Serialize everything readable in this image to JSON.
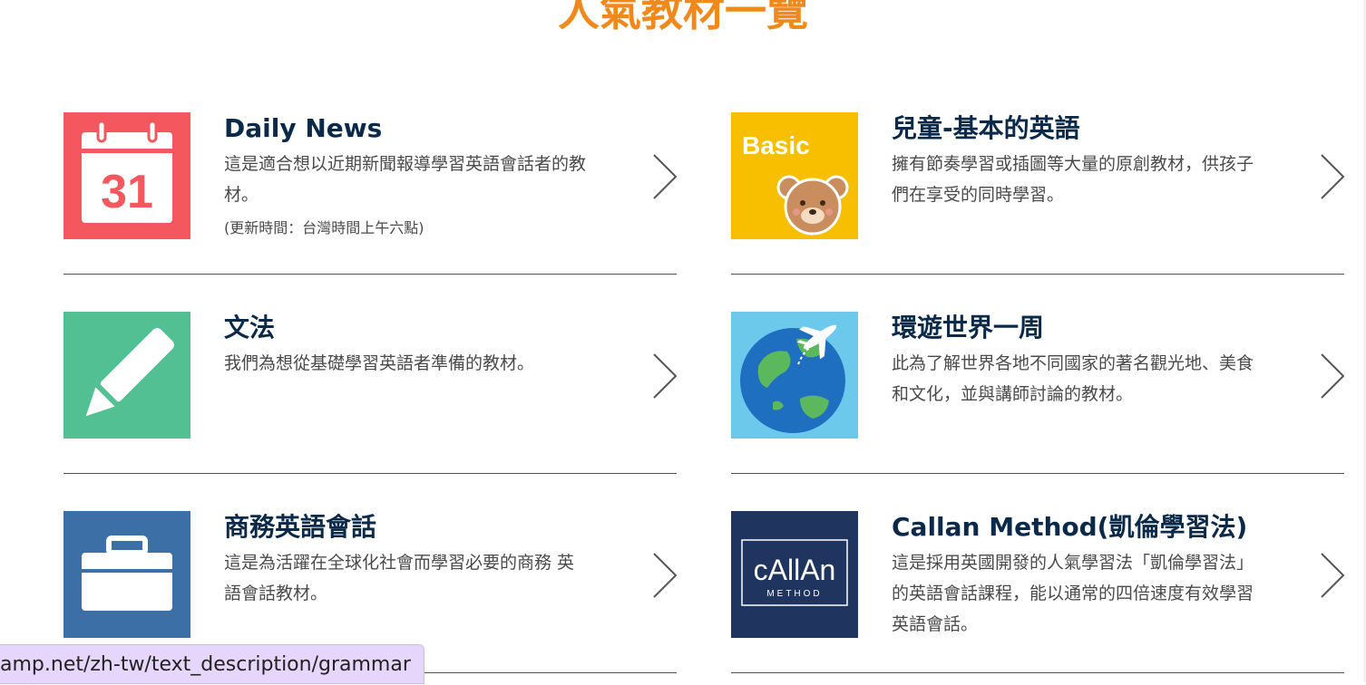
{
  "page": {
    "title": "人氣教材一覽"
  },
  "materials": [
    {
      "title": "Daily News",
      "description": "這是適合想以近期新聞報導學習英語會話者的教材。",
      "note": "(更新時間：台灣時間上午六點)",
      "icon": "calendar-icon",
      "icon_text": "31",
      "color": "#f4585e"
    },
    {
      "title": "兒童-基本的英語",
      "description": "擁有節奏學習或插圖等大量的原創教材，供孩子們在享受的同時學習。",
      "icon": "bear-icon",
      "icon_text": "Basic",
      "color": "#f8be00"
    },
    {
      "title": "文法",
      "description": "我們為想從基礎學習英語者準備的教材。",
      "icon": "pencil-icon",
      "color": "#53c094"
    },
    {
      "title": "環遊世界一周",
      "description": "此為了解世界各地不同國家的著名觀光地、美食和文化，並與講師討論的教材。",
      "icon": "globe-airplane-icon",
      "color": "#6cc9ec"
    },
    {
      "title": "商務英語會話",
      "description": "這是為活躍在全球化社會而學習必要的商務 英語會話教材。",
      "icon": "briefcase-icon",
      "color": "#3b6fa6"
    },
    {
      "title": "Callan Method(凱倫學習法)",
      "description": "這是採用英國開發的人氣學習法「凱倫學習法」的英語會話課程，能以通常的四倍速度有效學習英語會話。",
      "icon": "callan-logo-icon",
      "icon_text": "cAllAn",
      "icon_subtext": "METHOD",
      "color": "#1f3560"
    }
  ],
  "status_bar": {
    "url": "amp.net/zh-tw/text_description/grammar"
  }
}
